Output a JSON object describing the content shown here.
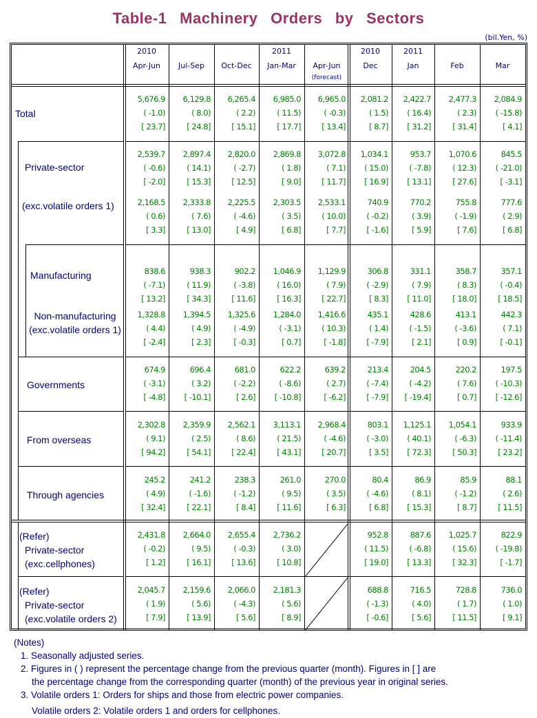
{
  "title": "Table-1   Machinery   Orders   by   Sectors",
  "unit": "(bil.Yen, %)",
  "columns": [
    {
      "year": "2010",
      "period": "Apr-Jun",
      "note": ""
    },
    {
      "year": "",
      "period": "Jul-Sep",
      "note": ""
    },
    {
      "year": "",
      "period": "Oct-Dec",
      "note": ""
    },
    {
      "year": "2011",
      "period": "Jan-Mar",
      "note": ""
    },
    {
      "year": "",
      "period": "Apr-Jun",
      "note": "(forecast)"
    },
    {
      "year": "2010",
      "period": "Dec",
      "note": ""
    },
    {
      "year": "2011",
      "period": "Jan",
      "note": ""
    },
    {
      "year": "",
      "period": "Feb",
      "note": ""
    },
    {
      "year": "",
      "period": "Mar",
      "note": ""
    }
  ],
  "rows": [
    {
      "label": [
        "Total"
      ],
      "values": [
        [
          "5,676.9",
          "( -1.0)",
          "[ 23.7]"
        ],
        [
          "6,129.8",
          "( 8.0)",
          "[ 24.8]"
        ],
        [
          "6,265.4",
          "( 2.2)",
          "[ 15.1]"
        ],
        [
          "6,985.0",
          "( 11.5)",
          "[ 17.7]"
        ],
        [
          "6,965.0",
          "( -0.3)",
          "[ 13.4]"
        ],
        [
          "2,081.2",
          "( 1.5)",
          "[ 8.7]"
        ],
        [
          "2,422.7",
          "( 16.4)",
          "[ 31.2]"
        ],
        [
          "2,477.3",
          "( 2.3)",
          "[ 31.4]"
        ],
        [
          "2,084.9",
          "( -15.8)",
          "[ 4.1]"
        ]
      ]
    },
    {
      "label": [
        "Private-sector"
      ],
      "values": [
        [
          "2,539.7",
          "( -0.6)",
          "[ -2.0]"
        ],
        [
          "2,897.4",
          "( 14.1)",
          "[ 15.3]"
        ],
        [
          "2,820.0",
          "( -2.7)",
          "[ 12.5]"
        ],
        [
          "2,869.8",
          "( 1.8)",
          "[ 9.0]"
        ],
        [
          "3,072.8",
          "( 7.1)",
          "[ 11.7]"
        ],
        [
          "1,034.1",
          "( 15.0)",
          "[ 16.9]"
        ],
        [
          "953.7",
          "( -7.8)",
          "[ 13.1]"
        ],
        [
          "1,070.6",
          "( 12.3)",
          "[ 27.6]"
        ],
        [
          "845.5",
          "( -21.0)",
          "[ -3.1]"
        ]
      ]
    },
    {
      "label": [
        "(exc.volatile orders 1)"
      ],
      "values": [
        [
          "2,168.5",
          "( 0.6)",
          "[ 3.3]"
        ],
        [
          "2,333.8",
          "( 7.6)",
          "[ 13.0]"
        ],
        [
          "2,225.5",
          "( -4.6)",
          "[ 4.9]"
        ],
        [
          "2,303.5",
          "( 3.5)",
          "[ 6.8]"
        ],
        [
          "2,533.1",
          "( 10.0)",
          "[ 7.7]"
        ],
        [
          "740.9",
          "( -0.2)",
          "[ -1.6]"
        ],
        [
          "770.2",
          "( 3.9)",
          "[ 5.9]"
        ],
        [
          "755.8",
          "( -1.9)",
          "[ 7.6]"
        ],
        [
          "777.6",
          "( 2.9)",
          "[ 6.8]"
        ]
      ]
    },
    {
      "label": [
        "Manufacturing"
      ],
      "values": [
        [
          "838.6",
          "( -7.1)",
          "[ 13.2]"
        ],
        [
          "938.3",
          "( 11.9)",
          "[ 34.3]"
        ],
        [
          "902.2",
          "( -3.8)",
          "[ 11.6]"
        ],
        [
          "1,046.9",
          "( 16.0)",
          "[ 16.3]"
        ],
        [
          "1,129.9",
          "( 7.9)",
          "[ 22.7]"
        ],
        [
          "306.8",
          "( -2.9)",
          "[ 8.3]"
        ],
        [
          "331.1",
          "( 7.9)",
          "[ 11.0]"
        ],
        [
          "358.7",
          "( 8.3)",
          "[ 18.0]"
        ],
        [
          "357.1",
          "( -0.4)",
          "[ 18.5]"
        ]
      ]
    },
    {
      "label": [
        "Non-manufacturing",
        "(exc.volatile orders 1)"
      ],
      "values": [
        [
          "1,328.8",
          "( 4.4)",
          "[ -2.4]"
        ],
        [
          "1,394.5",
          "( 4.9)",
          "[ 2.3]"
        ],
        [
          "1,325.6",
          "( -4.9)",
          "[ -0.3]"
        ],
        [
          "1,284.0",
          "( -3.1)",
          "[ 0.7]"
        ],
        [
          "1,416.6",
          "( 10.3)",
          "[ -1.8]"
        ],
        [
          "435.1",
          "( 1.4)",
          "[ -7.9]"
        ],
        [
          "428.6",
          "( -1.5)",
          "[ 2.1]"
        ],
        [
          "413.1",
          "( -3.6)",
          "[ 0.9]"
        ],
        [
          "442.3",
          "( 7.1)",
          "[ -0.1]"
        ]
      ]
    },
    {
      "label": [
        "Governments"
      ],
      "values": [
        [
          "674.9",
          "( -3.1)",
          "[ -4.8]"
        ],
        [
          "696.4",
          "( 3.2)",
          "[ -10.1]"
        ],
        [
          "681.0",
          "( -2.2)",
          "[ 2.6]"
        ],
        [
          "622.2",
          "( -8.6)",
          "[ -10.8]"
        ],
        [
          "639.2",
          "( 2.7)",
          "[ -6.2]"
        ],
        [
          "213.4",
          "( -7.4)",
          "[ -7.9]"
        ],
        [
          "204.5",
          "( -4.2)",
          "[ -19.4]"
        ],
        [
          "220.2",
          "( 7.6)",
          "[ 0.7]"
        ],
        [
          "197.5",
          "( -10.3)",
          "[ -12.6]"
        ]
      ]
    },
    {
      "label": [
        "From overseas"
      ],
      "values": [
        [
          "2,302.8",
          "( 9.1)",
          "[ 94.2]"
        ],
        [
          "2,359.9",
          "( 2.5)",
          "[ 54.1]"
        ],
        [
          "2,562.1",
          "( 8.6)",
          "[ 22.4]"
        ],
        [
          "3,113.1",
          "( 21.5)",
          "[ 43.1]"
        ],
        [
          "2,968.4",
          "( -4.6)",
          "[ 20.7]"
        ],
        [
          "803.1",
          "( -3.0)",
          "[ 3.5]"
        ],
        [
          "1,125.1",
          "( 40.1)",
          "[ 72.3]"
        ],
        [
          "1,054.1",
          "( -6.3)",
          "[ 50.3]"
        ],
        [
          "933.9",
          "( -11.4)",
          "[ 23.2]"
        ]
      ]
    },
    {
      "label": [
        "Through agencies"
      ],
      "values": [
        [
          "245.2",
          "( 4.9)",
          "[ 32.4]"
        ],
        [
          "241.2",
          "( -1.6)",
          "[ 22.1]"
        ],
        [
          "238.3",
          "( -1.2)",
          "[ 8.4]"
        ],
        [
          "261.0",
          "( 9.5)",
          "[ 11.6]"
        ],
        [
          "270.0",
          "( 3.5)",
          "[ 6.3]"
        ],
        [
          "80.4",
          "( -4.6)",
          "[ 6.8]"
        ],
        [
          "86.9",
          "( 8.1)",
          "[ 15.3]"
        ],
        [
          "85.9",
          "( -1.2)",
          "[ 8.7]"
        ],
        [
          "88.1",
          "( 2.6)",
          "[ 11.5]"
        ]
      ]
    },
    {
      "label": [
        "(Refer)",
        "Private-sector",
        "(exc.cellphones)"
      ],
      "values": [
        [
          "2,431.8",
          "( -0.2)",
          "[ 1.2]"
        ],
        [
          "2,664.0",
          "( 9.5)",
          "[ 16.1]"
        ],
        [
          "2,655.4",
          "( -0.3)",
          "[ 13.6]"
        ],
        [
          "2,736.2",
          "( 3.0)",
          "[ 10.8]"
        ],
        null,
        [
          "952.8",
          "( 11.5)",
          "[ 19.0]"
        ],
        [
          "887.6",
          "( -6.8)",
          "[ 13.3]"
        ],
        [
          "1,025.7",
          "( 15.6)",
          "[ 32.3]"
        ],
        [
          "822.9",
          "( -19.8)",
          "[ -1.7]"
        ]
      ]
    },
    {
      "label": [
        "(Refer)",
        "Private-sector",
        "(exc.volatile orders 2)"
      ],
      "values": [
        [
          "2,045.7",
          "( 1.9)",
          "[ 7.9]"
        ],
        [
          "2,159.6",
          "( 5.6)",
          "[ 13.9]"
        ],
        [
          "2,066.0",
          "( -4.3)",
          "[ 5.6]"
        ],
        [
          "2,181.3",
          "( 5.6)",
          "[ 8.9]"
        ],
        null,
        [
          "688.8",
          "( -1.3)",
          "[ -0.6]"
        ],
        [
          "716.5",
          "( 4.0)",
          "[ 5.6]"
        ],
        [
          "728.8",
          "( 1.7)",
          "[ 11.5]"
        ],
        [
          "736.0",
          "( 1.0)",
          "[ 9.1]"
        ]
      ]
    }
  ],
  "notes": {
    "heading": "(Notes)",
    "items": [
      "1. Seasonally adjusted series.",
      "2. Figures in ( ) represent the percentage change from the previous quarter (month). Figures in [ ] are",
      "the percentage change from the corresponding quarter (month) of the previous year in original series.",
      "3. Volatile orders 1: Orders for ships and those from electric power companies.",
      "Volatile orders 2: Volatile orders 1 and orders for cellphones."
    ]
  }
}
